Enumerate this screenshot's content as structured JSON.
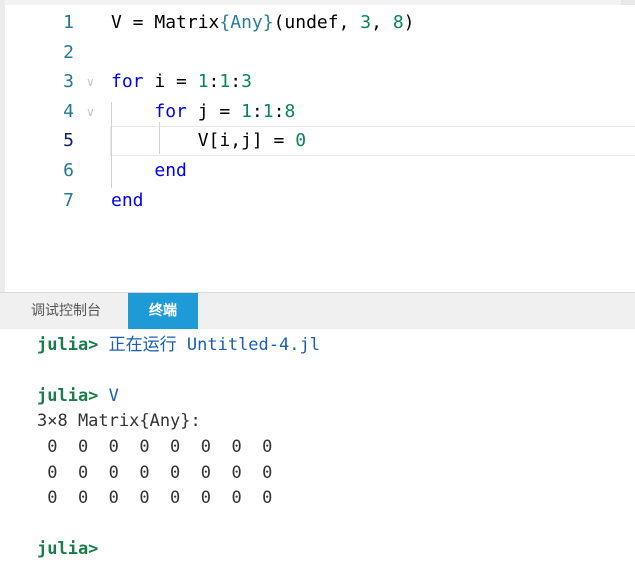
{
  "editor": {
    "lines": [
      {
        "num": "1",
        "tokens": [
          [
            "",
            "V = "
          ],
          [
            "",
            "Matrix"
          ],
          [
            "type",
            "{Any}"
          ],
          [
            "",
            "(undef, "
          ],
          [
            "num",
            "3"
          ],
          [
            "",
            ", "
          ],
          [
            "num",
            "8"
          ],
          [
            "",
            ")"
          ]
        ]
      },
      {
        "num": "2",
        "tokens": []
      },
      {
        "num": "3",
        "tokens": [
          [
            "kw",
            "for"
          ],
          [
            "",
            " i = "
          ],
          [
            "num",
            "1"
          ],
          [
            "",
            ":"
          ],
          [
            "num",
            "1"
          ],
          [
            "",
            ":"
          ],
          [
            "num",
            "3"
          ]
        ],
        "fold": true
      },
      {
        "num": "4",
        "tokens": [
          [
            "",
            "    "
          ],
          [
            "kw",
            "for"
          ],
          [
            "",
            " j = "
          ],
          [
            "num",
            "1"
          ],
          [
            "",
            ":"
          ],
          [
            "num",
            "1"
          ],
          [
            "",
            ":"
          ],
          [
            "num",
            "8"
          ]
        ],
        "fold": true
      },
      {
        "num": "5",
        "tokens": [
          [
            "",
            "        V[i,j] = "
          ],
          [
            "num",
            "0"
          ]
        ],
        "current": true
      },
      {
        "num": "6",
        "tokens": [
          [
            "",
            "    "
          ],
          [
            "kw",
            "end"
          ]
        ]
      },
      {
        "num": "7",
        "tokens": [
          [
            "kw",
            "end"
          ]
        ]
      }
    ]
  },
  "panel": {
    "tabs": [
      {
        "label": "调试控制台",
        "active": false
      },
      {
        "label": "终端",
        "active": true
      }
    ]
  },
  "terminal": {
    "prompt": "julia>",
    "lines": [
      {
        "prompt": "julia>",
        "text": " 正在运行 Untitled-4.jl",
        "kind": "cmd"
      },
      {
        "prompt": "",
        "text": "",
        "kind": "out"
      },
      {
        "prompt": "julia>",
        "text": " V",
        "kind": "cmd"
      },
      {
        "prompt": "",
        "text": "3×8 Matrix{Any}:",
        "kind": "out"
      },
      {
        "prompt": "",
        "text": " 0  0  0  0  0  0  0  0",
        "kind": "out"
      },
      {
        "prompt": "",
        "text": " 0  0  0  0  0  0  0  0",
        "kind": "out"
      },
      {
        "prompt": "",
        "text": " 0  0  0  0  0  0  0  0",
        "kind": "out"
      },
      {
        "prompt": "",
        "text": "",
        "kind": "out"
      },
      {
        "prompt": "julia>",
        "text": "",
        "kind": "cmd"
      }
    ]
  },
  "colors": {
    "tab_active_bg": "#1e9bd7",
    "keyword": "#0000ff",
    "number": "#098658",
    "type": "#267f99",
    "prompt": "#1a7c4a"
  }
}
